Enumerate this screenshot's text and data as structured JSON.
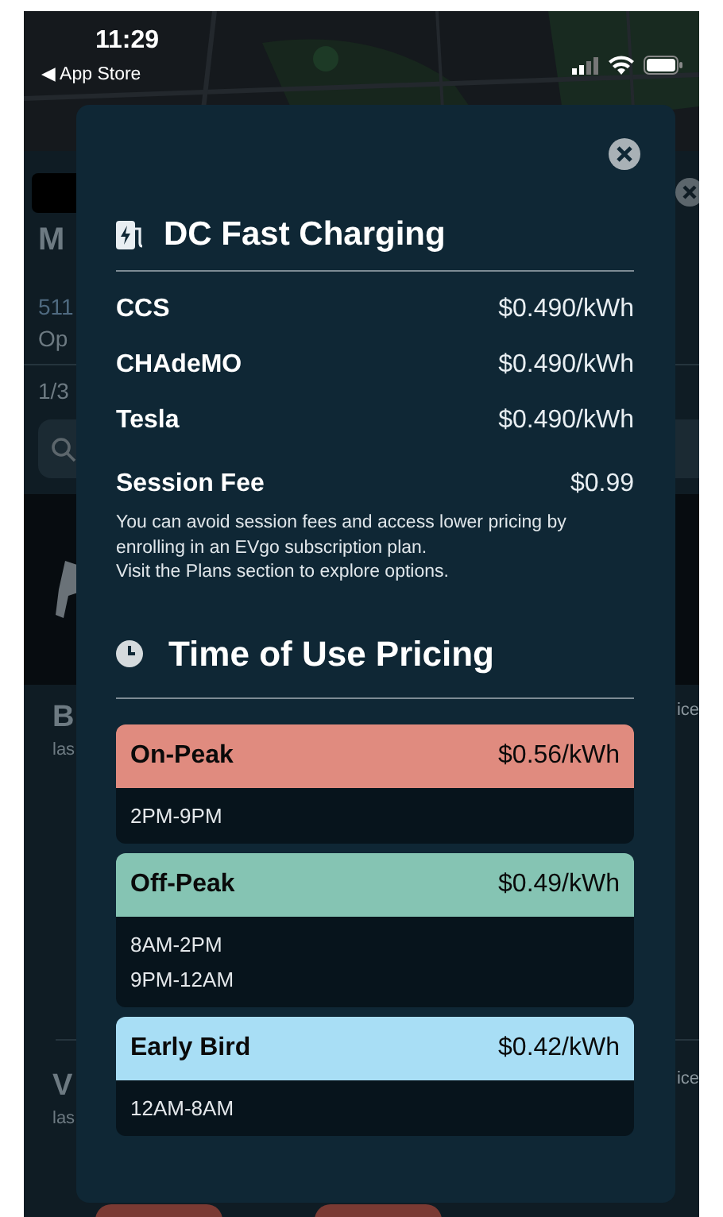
{
  "status_bar": {
    "time": "11:29",
    "back_link": "◀ App Store"
  },
  "background": {
    "title_fragment": "M",
    "address_fragment": "511",
    "hours_fragment": "Op",
    "count_fragment": "1/3",
    "list": [
      {
        "title": "B",
        "subtitle": "las",
        "trailing": "ice"
      },
      {
        "title": "V",
        "subtitle": "las",
        "trailing": "ice"
      }
    ]
  },
  "modal": {
    "title": "DC Fast Charging",
    "connectors": [
      {
        "name": "CCS",
        "price": "$0.490/kWh"
      },
      {
        "name": "CHAdeMO",
        "price": "$0.490/kWh"
      },
      {
        "name": "Tesla",
        "price": "$0.490/kWh"
      }
    ],
    "session_fee": {
      "label": "Session Fee",
      "price": "$0.99",
      "note": [
        "You can avoid session fees and access lower pricing by enrolling in an EVgo subscription plan.",
        "Visit the Plans section to explore options."
      ]
    },
    "time_of_use": {
      "title": "Time of Use Pricing",
      "periods": [
        {
          "name": "On-Peak",
          "price": "$0.56/kWh",
          "color": "#e08b7f",
          "hours": [
            "2PM-9PM"
          ]
        },
        {
          "name": "Off-Peak",
          "price": "$0.49/kWh",
          "color": "#85c4b3",
          "hours": [
            "8AM-2PM",
            "9PM-12AM"
          ]
        },
        {
          "name": "Early Bird",
          "price": "$0.42/kWh",
          "color": "#a8def5",
          "hours": [
            "12AM-8AM"
          ]
        }
      ]
    }
  }
}
